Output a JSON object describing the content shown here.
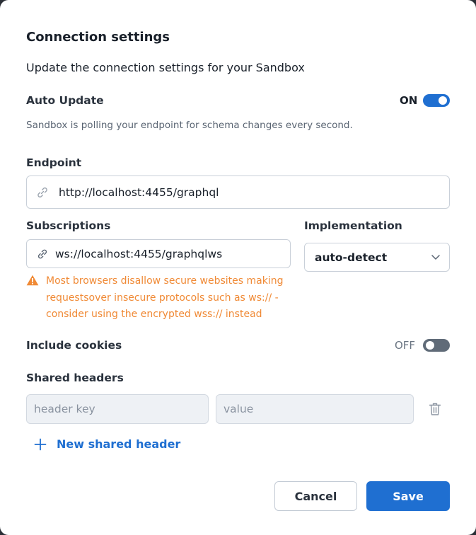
{
  "dialog": {
    "title": "Connection settings",
    "subtitle": "Update the connection settings for your Sandbox"
  },
  "auto_update": {
    "label": "Auto Update",
    "state_text": "ON",
    "enabled": true,
    "help": "Sandbox is polling your endpoint for schema changes every second."
  },
  "endpoint": {
    "label": "Endpoint",
    "value": "http://localhost:4455/graphql",
    "icon": "link-icon"
  },
  "subscriptions": {
    "label": "Subscriptions",
    "value": "ws://localhost:4455/graphqlws",
    "icon": "link-icon",
    "warning": "Most browsers disallow secure websites making requestsover insecure protocols such as ws:// - consider using the encrypted wss:// instead"
  },
  "implementation": {
    "label": "Implementation",
    "selected": "auto-detect"
  },
  "include_cookies": {
    "label": "Include cookies",
    "state_text": "OFF",
    "enabled": false
  },
  "shared_headers": {
    "label": "Shared headers",
    "key_placeholder": "header key",
    "value_placeholder": "value",
    "add_label": "New shared header"
  },
  "actions": {
    "cancel_label": "Cancel",
    "save_label": "Save"
  },
  "colors": {
    "accent": "#1f6fd1",
    "warning": "#f08a36"
  }
}
